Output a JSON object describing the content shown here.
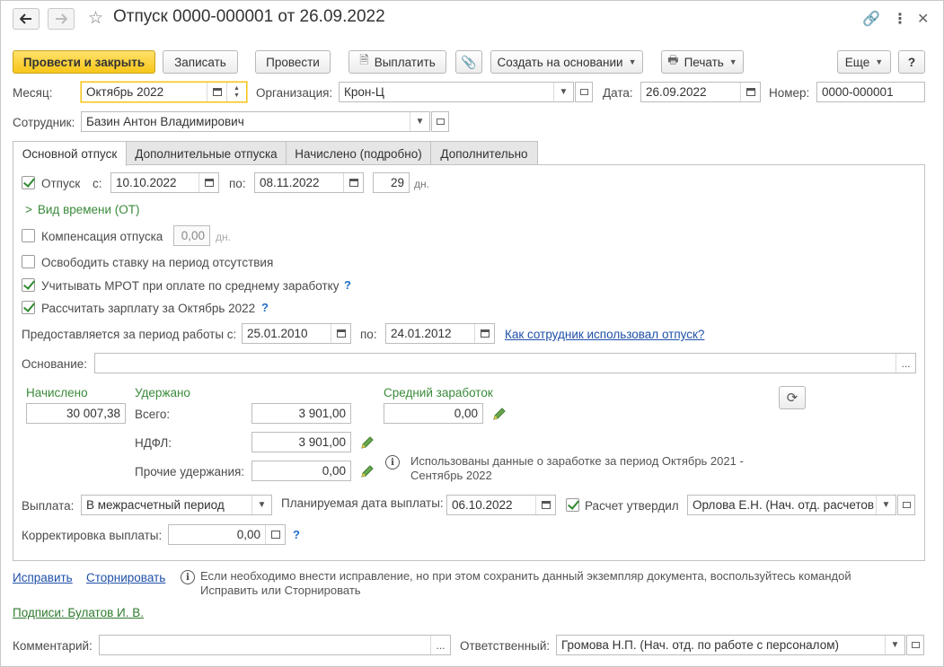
{
  "window": {
    "title": "Отпуск 0000-000001 от 26.09.2022"
  },
  "toolbar": {
    "post_close": "Провести и закрыть",
    "save": "Записать",
    "post": "Провести",
    "pay": "Выплатить",
    "create_based": "Создать на основании",
    "print": "Печать",
    "more": "Еще",
    "help": "?"
  },
  "header": {
    "month_label": "Месяц:",
    "month_value": "Октябрь 2022",
    "org_label": "Организация:",
    "org_value": "Крон-Ц",
    "date_label": "Дата:",
    "date_value": "26.09.2022",
    "number_label": "Номер:",
    "number_value": "0000-000001",
    "employee_label": "Сотрудник:",
    "employee_value": "Базин Антон Владимирович"
  },
  "tabs": [
    {
      "label": "Основной отпуск"
    },
    {
      "label": "Дополнительные отпуска"
    },
    {
      "label": "Начислено (подробно)"
    },
    {
      "label": "Дополнительно"
    }
  ],
  "main": {
    "vacation_label": "Отпуск",
    "from_label": "с:",
    "from_value": "10.10.2022",
    "to_label": "по:",
    "to_value": "08.11.2022",
    "days_value": "29",
    "days_unit": "дн.",
    "time_kind": "Вид времени (ОТ)",
    "compensation_label": "Компенсация отпуска",
    "compensation_value": "0,00",
    "compensation_unit": "дн.",
    "free_rate_label": "Освободить ставку на период отсутствия",
    "mrot_label": "Учитывать МРОТ при оплате по среднему заработку",
    "calc_salary_label": "Рассчитать зарплату за Октябрь 2022",
    "period_label": "Предоставляется за период работы с:",
    "period_from": "25.01.2010",
    "period_to_label": "по:",
    "period_to": "24.01.2012",
    "usage_link": "Как сотрудник использовал отпуск?",
    "basis_label": "Основание:",
    "basis_value": "",
    "accrued_label": "Начислено",
    "accrued_value": "30 007,38",
    "withheld_label": "Удержано",
    "total_label": "Всего:",
    "total_value": "3 901,00",
    "ndfl_label": "НДФЛ:",
    "ndfl_value": "3 901,00",
    "other_label": "Прочие удержания:",
    "other_value": "0,00",
    "avg_label": "Средний заработок",
    "avg_value": "0,00",
    "info_text_1": "Использованы данные о заработке за период Октябрь 2021 -",
    "info_text_2": "Сентябрь 2022",
    "payment_label": "Выплата:",
    "payment_value": "В межрасчетный период",
    "planned_date_label": "Планируемая дата выплаты:",
    "planned_date_value": "06.10.2022",
    "approved_label": "Расчет утвердил",
    "approved_value": "Орлова Е.Н. (Нач. отд. расчетов",
    "correction_label": "Корректировка выплаты:",
    "correction_value": "0,00"
  },
  "footer": {
    "fix_link": "Исправить",
    "reverse_link": "Сторнировать",
    "hint_1": "Если необходимо внести исправление, но при этом сохранить данный экземпляр документа, воспользуйтесь командой",
    "hint_2": "Исправить или Сторнировать",
    "signatures_link": "Подписи: Булатов И. В.",
    "comment_label": "Комментарий:",
    "comment_value": "",
    "responsible_label": "Ответственный:",
    "responsible_value": "Громова Н.П. (Нач. отд. по работе с персоналом)"
  },
  "icons": {
    "back": "arrow-left-icon",
    "forward": "arrow-right-icon",
    "favorite": "star-icon",
    "link": "link-icon",
    "menu": "more-vertical-icon",
    "close": "close-icon"
  }
}
